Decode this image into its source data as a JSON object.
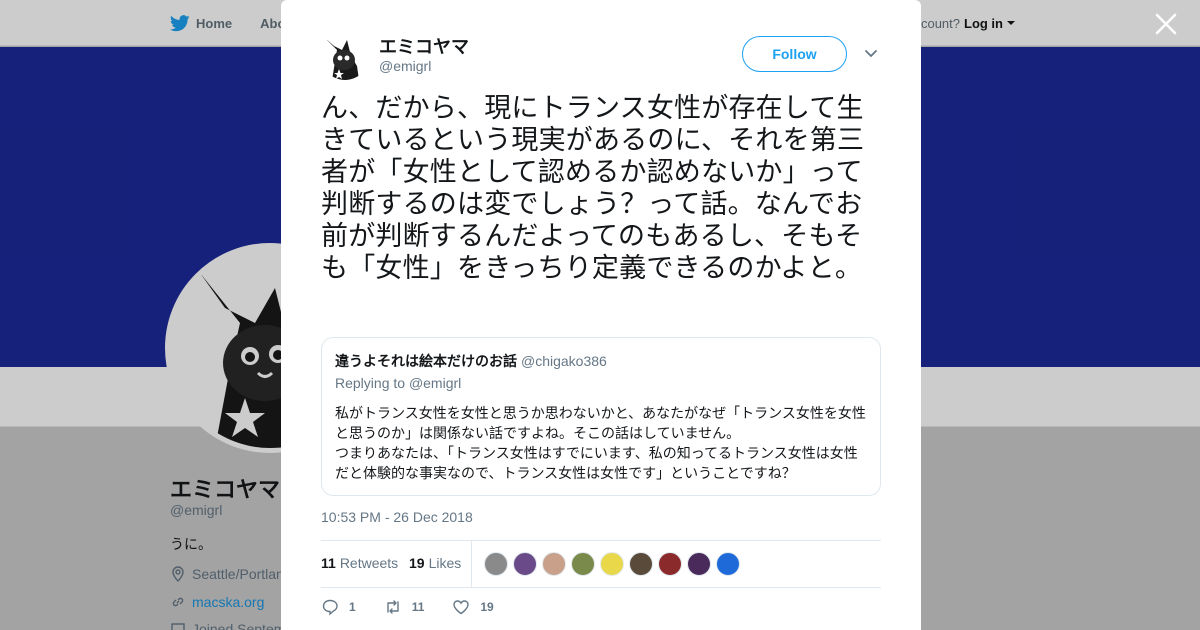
{
  "topbar": {
    "home_label": "Home",
    "about_label": "Abo",
    "account_text": "account?",
    "login_label": "Log in"
  },
  "profile": {
    "name": "エミコヤマ",
    "handle": "@emigrl",
    "bio": "うに。",
    "location": "Seattle/Portlan",
    "website": "macska.org",
    "joined": "Joined Septem"
  },
  "tweet": {
    "author_name": "エミコヤマ",
    "author_handle": "@emigrl",
    "follow_label": "Follow",
    "text": "ん、だから、現にトランス女性が存在して生きているという現実があるのに、それを第三者が「女性として認めるか認めないか」って判断するのは変でしょう？って話。なんでお前が判断するんだよってのもあるし、そもそも「女性」をきっちり定義できるのかよと。",
    "timestamp": "10:53 PM - 26 Dec 2018",
    "retweets_count": "11",
    "retweets_label": "Retweets",
    "likes_count": "19",
    "likes_label": "Likes",
    "liker_colors": [
      "#8a8a8a",
      "#6b4a8a",
      "#c9a089",
      "#7a8a4a",
      "#e8d84a",
      "#5a4a3a",
      "#8a2a2a",
      "#4a2a5a",
      "#1d6ad8"
    ],
    "actions": {
      "reply_count": "1",
      "retweet_count": "11",
      "like_count": "19"
    }
  },
  "quote": {
    "name": "違うよそれは絵本だけのお話",
    "handle": "@chigako386",
    "replying_prefix": "Replying to",
    "replying_to": "@emigrl",
    "body_line1": "私がトランス女性を女性と思うか思わないかと、あなたがなぜ「トランス女性を女性と思うのか」は関係ない話ですよね。そこの話はしていません。",
    "body_line2": "つまりあなたは、「トランス女性はすでにいます、私の知ってるトランス女性は女性だと体験的な事実なので、トランス女性は女性です」ということですね？"
  },
  "colors": {
    "banner": "#1b2a99",
    "accent": "#1da1f2",
    "link": "#1b95e0"
  }
}
